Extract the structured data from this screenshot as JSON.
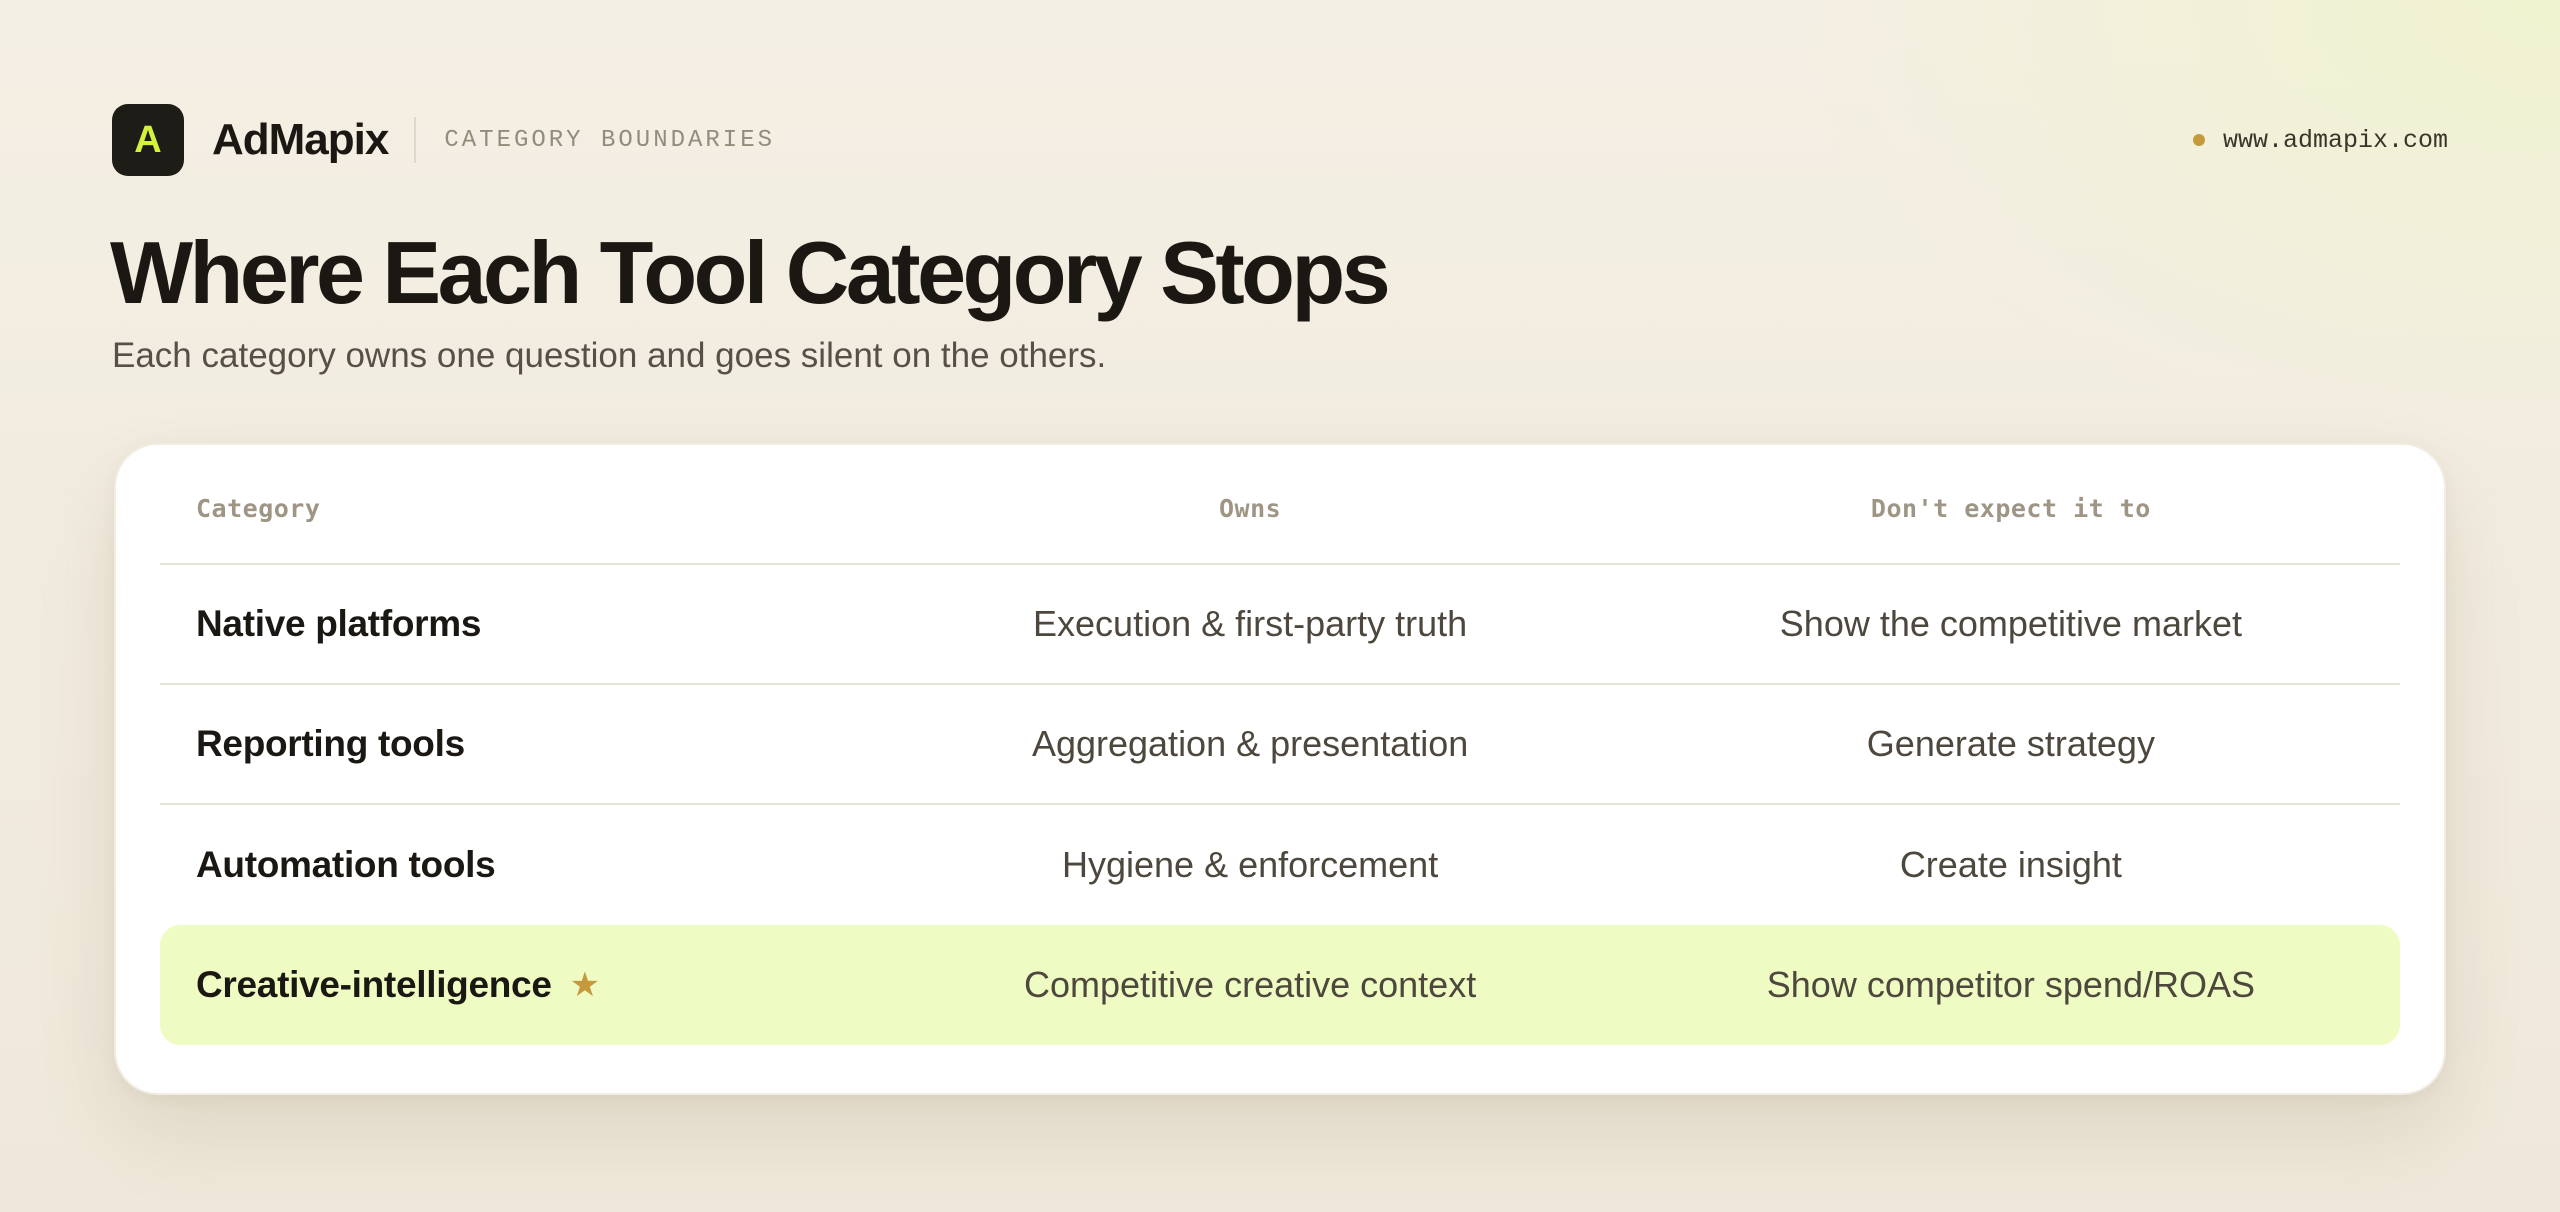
{
  "header": {
    "logo_letter": "A",
    "brand": "AdMapix",
    "eyebrow": "CATEGORY BOUNDARIES",
    "site": "www.admapix.com"
  },
  "title": "Where Each Tool Category Stops",
  "subtitle": "Each category owns one question and goes silent on the others.",
  "table": {
    "columns": [
      "Category",
      "Owns",
      "Don't expect it to"
    ],
    "rows": [
      {
        "category": "Native platforms",
        "owns": "Execution & first-party truth",
        "dont": "Show the competitive market"
      },
      {
        "category": "Reporting tools",
        "owns": "Aggregation & presentation",
        "dont": "Generate strategy"
      },
      {
        "category": "Automation tools",
        "owns": "Hygiene & enforcement",
        "dont": "Create insight"
      },
      {
        "category": "Creative-intelligence",
        "owns": "Competitive creative context",
        "dont": "Show competitor spend/ROAS",
        "marker": "★",
        "highlighted": true
      }
    ]
  },
  "colors": {
    "accent": "#d4f23c",
    "highlight_row": "#eefbc2",
    "star": "#c49a3d",
    "logo_bg": "#1e1c17"
  },
  "icons": {
    "star": "star-icon",
    "site_dot": "status-dot-icon"
  }
}
